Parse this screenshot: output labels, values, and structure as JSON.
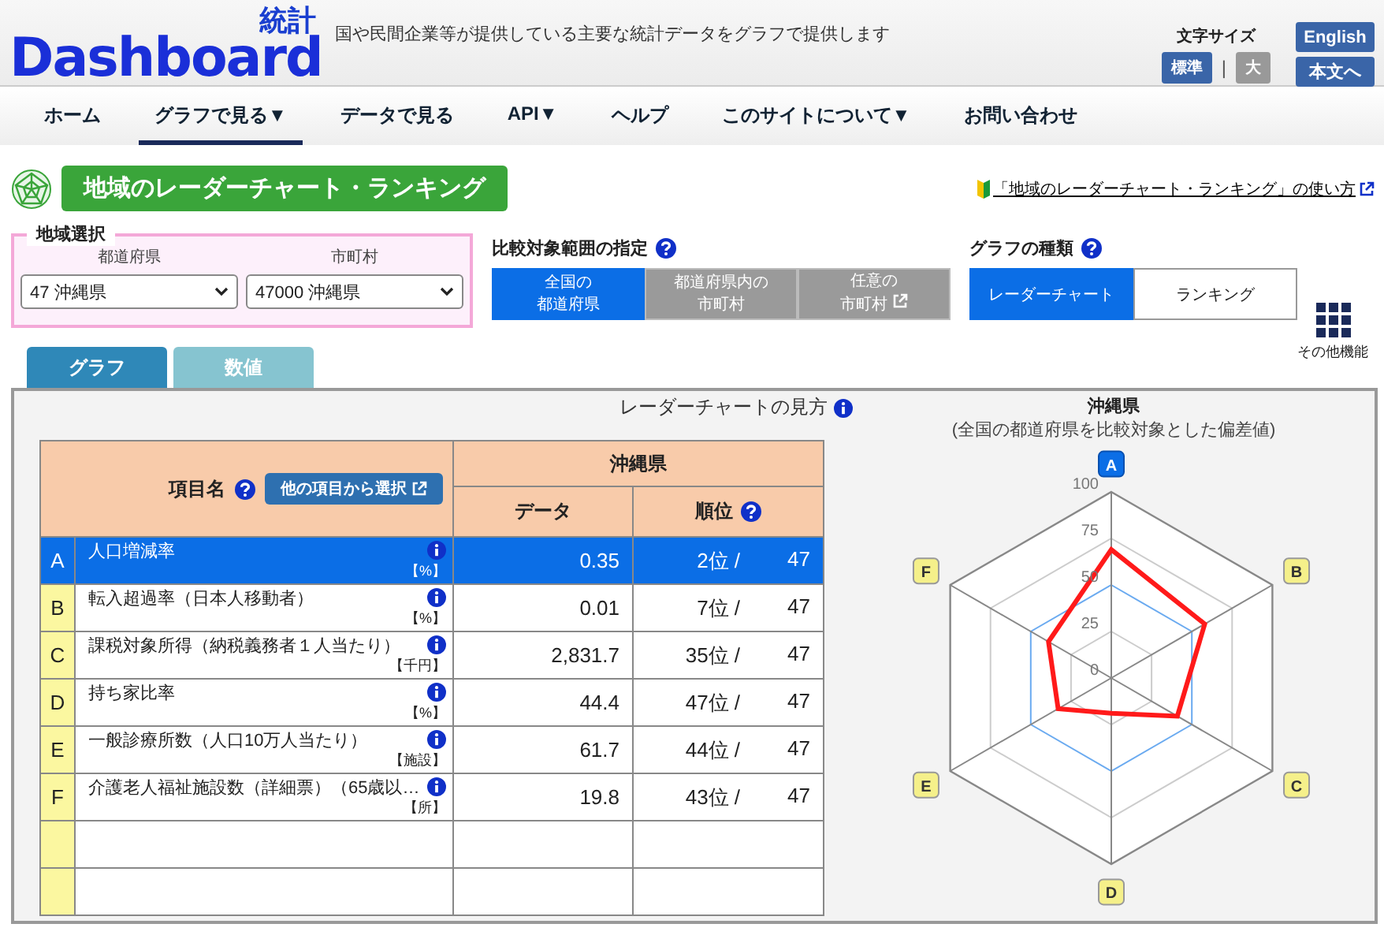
{
  "header": {
    "logo": {
      "text": "Dashboard",
      "sub": "統計"
    },
    "tagline": "国や民間企業等が提供している主要な統計データをグラフで提供します",
    "font_size": {
      "label": "文字サイズ",
      "options": [
        {
          "label": "標準",
          "selected": true
        },
        {
          "label": "大",
          "selected": false
        }
      ],
      "separator": "|"
    },
    "buttons": [
      "English",
      "本文へ"
    ]
  },
  "nav": [
    {
      "label": "ホーム",
      "selected": false
    },
    {
      "label": "グラフで見る▼",
      "selected": true
    },
    {
      "label": "データで見る",
      "selected": false
    },
    {
      "label": "API▼",
      "selected": false
    },
    {
      "label": "ヘルプ",
      "selected": false
    },
    {
      "label": "このサイトについて▼",
      "selected": false
    },
    {
      "label": "お問い合わせ",
      "selected": false
    }
  ],
  "page_title": "地域のレーダーチャート・ランキング",
  "help_link": "「地域のレーダーチャート・ランキング」の使い方",
  "region": {
    "legend": "地域選択",
    "prefecture": {
      "label": "都道府県",
      "value": "47 沖縄県"
    },
    "municipality": {
      "label": "市町村",
      "value": "47000 沖縄県"
    }
  },
  "scope": {
    "title": "比較対象範囲の指定",
    "options": [
      {
        "lines": [
          "全国の",
          "都道府県"
        ],
        "selected": true,
        "disabled": false,
        "external": false
      },
      {
        "lines": [
          "都道府県内の",
          "市町村"
        ],
        "selected": false,
        "disabled": true,
        "external": false
      },
      {
        "lines": [
          "任意の",
          "市町村"
        ],
        "selected": false,
        "disabled": true,
        "external": true
      }
    ]
  },
  "graph_type": {
    "title": "グラフの種類",
    "options": [
      {
        "label": "レーダーチャート",
        "selected": true
      },
      {
        "label": "ランキング",
        "selected": false
      }
    ]
  },
  "more": "その他機能",
  "tabs": [
    {
      "label": "グラフ",
      "selected": true
    },
    {
      "label": "数値",
      "selected": false
    }
  ],
  "radar_guide": "レーダーチャートの見方",
  "table": {
    "item_header": "項目名",
    "select_button": "他の項目から選択",
    "region": "沖縄県",
    "columns": [
      "データ",
      "順位"
    ],
    "rows": [
      {
        "letter": "A",
        "name": "人口増減率",
        "unit": "【%】",
        "value": "0.35",
        "rank": "2位 /",
        "total": "47",
        "selected": true
      },
      {
        "letter": "B",
        "name": "転入超過率（日本人移動者）",
        "unit": "【%】",
        "value": "0.01",
        "rank": "7位 /",
        "total": "47",
        "selected": false
      },
      {
        "letter": "C",
        "name": "課税対象所得（納税義務者１人当たり）",
        "unit": "【千円】",
        "value": "2,831.7",
        "rank": "35位 /",
        "total": "47",
        "selected": false
      },
      {
        "letter": "D",
        "name": "持ち家比率",
        "unit": "【%】",
        "value": "44.4",
        "rank": "47位 /",
        "total": "47",
        "selected": false
      },
      {
        "letter": "E",
        "name": "一般診療所数（人口10万人当たり）",
        "unit": "【施設】",
        "value": "61.7",
        "rank": "44位 /",
        "total": "47",
        "selected": false
      },
      {
        "letter": "F",
        "name": "介護老人福祉施設数（詳細票）（65歳以…",
        "unit": "【所】",
        "value": "19.8",
        "rank": "43位 /",
        "total": "47",
        "selected": false
      }
    ]
  },
  "chart": {
    "title": "沖縄県",
    "subtitle": "(全国の都道府県を比較対象とした偏差値)",
    "tick_labels": [
      "100",
      "75",
      "50",
      "25",
      "0"
    ],
    "axes": [
      {
        "label": "A",
        "selected": true
      },
      {
        "label": "B",
        "selected": false
      },
      {
        "label": "C",
        "selected": false
      },
      {
        "label": "D",
        "selected": false
      },
      {
        "label": "E",
        "selected": false
      },
      {
        "label": "F",
        "selected": false
      }
    ]
  }
}
